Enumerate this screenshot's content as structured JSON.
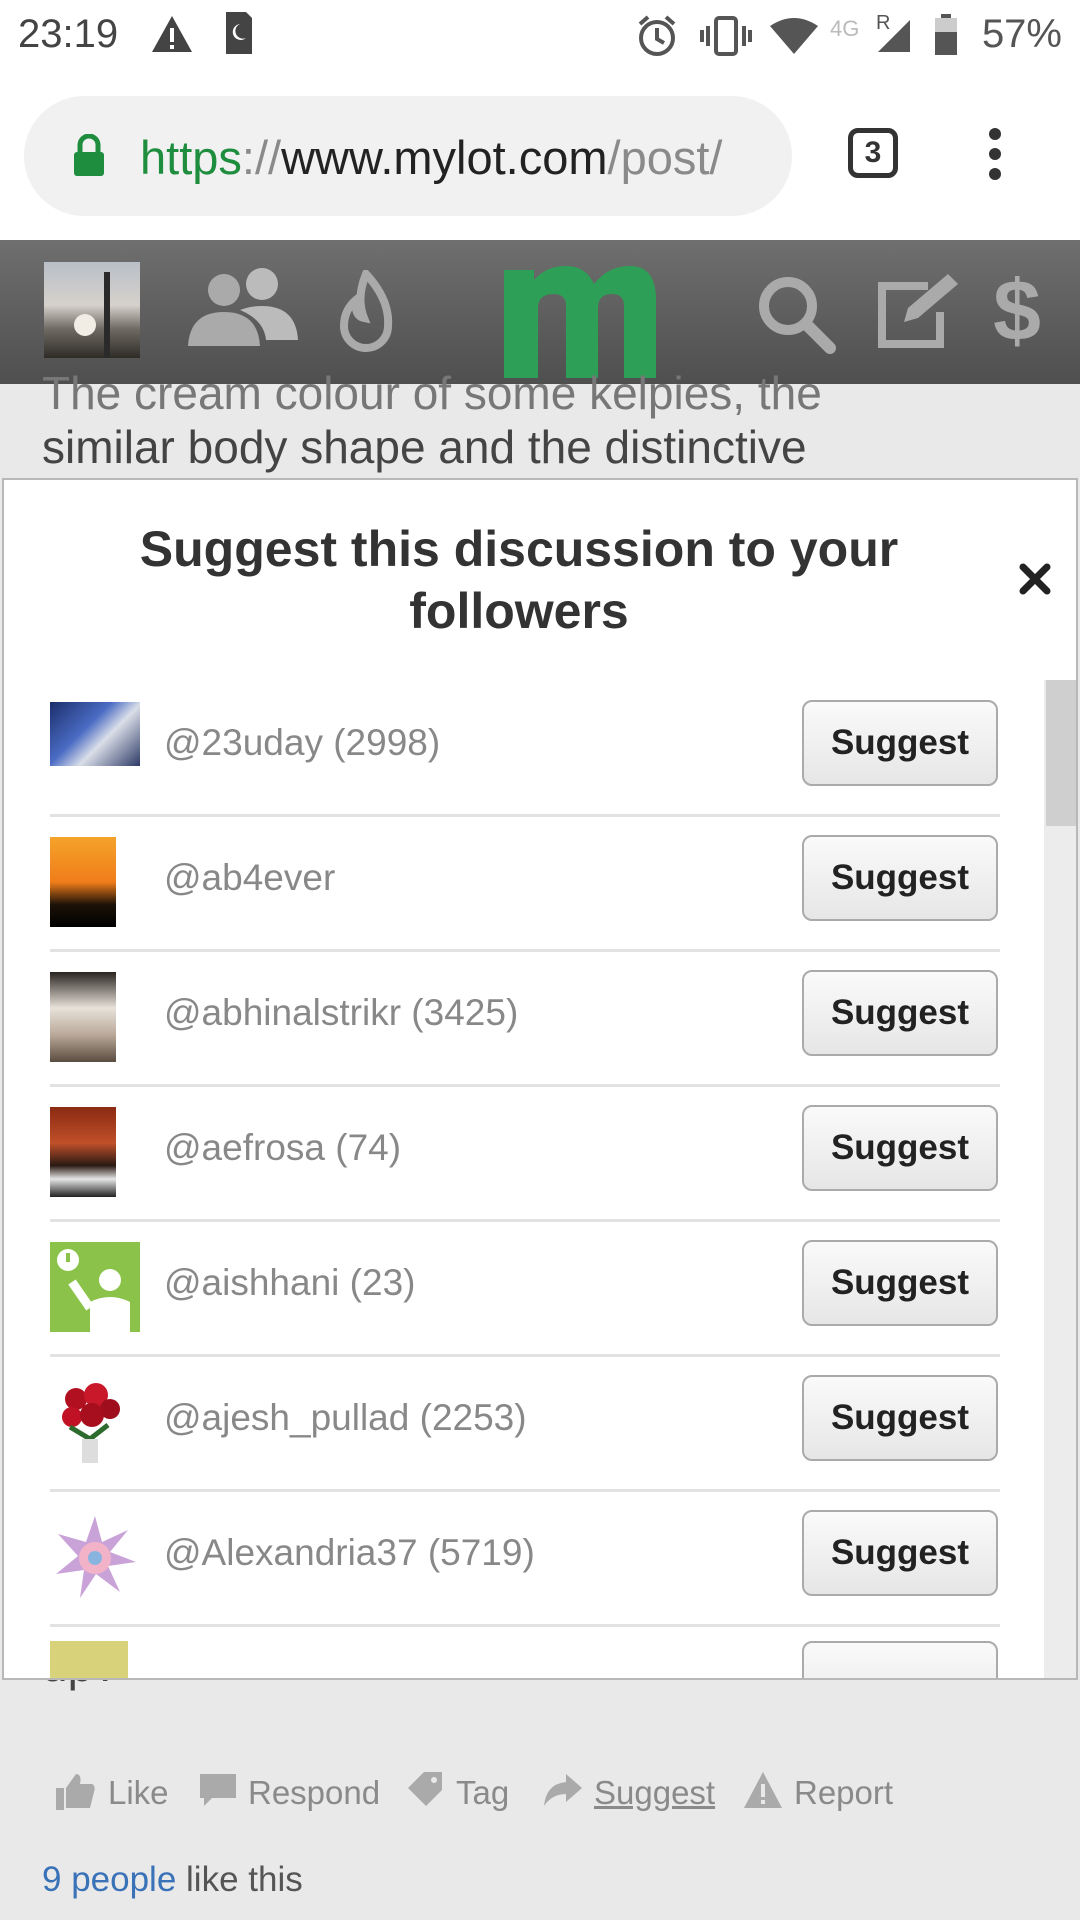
{
  "status_bar": {
    "time": "23:19",
    "network": "4G",
    "roaming": "R",
    "battery": "57%"
  },
  "browser": {
    "url_scheme": "https",
    "url_sep": "://",
    "url_host": "www.mylot.com",
    "url_path": "/post/",
    "tab_count": "3"
  },
  "site_nav": {
    "logo": "m"
  },
  "background": {
    "line1": "The cream colour of some kelpies, the",
    "line2": "similar body shape and the distinctive",
    "line3": "up?"
  },
  "modal": {
    "title_line1": "Suggest this discussion to your",
    "title_line2": "followers",
    "close": "×",
    "suggest_label": "Suggest",
    "followers": [
      {
        "name": "@23uday (2998)"
      },
      {
        "name": "@ab4ever"
      },
      {
        "name": "@abhinalstrikr (3425)"
      },
      {
        "name": "@aefrosa (74)"
      },
      {
        "name": "@aishhani (23)"
      },
      {
        "name": "@ajesh_pullad (2253)"
      },
      {
        "name": "@Alexandria37 (5719)"
      }
    ]
  },
  "actions": {
    "like": "Like",
    "respond": "Respond",
    "tag": "Tag",
    "suggest": "Suggest",
    "report": "Report"
  },
  "likes": {
    "link": "9 people",
    "suffix": " like this"
  }
}
